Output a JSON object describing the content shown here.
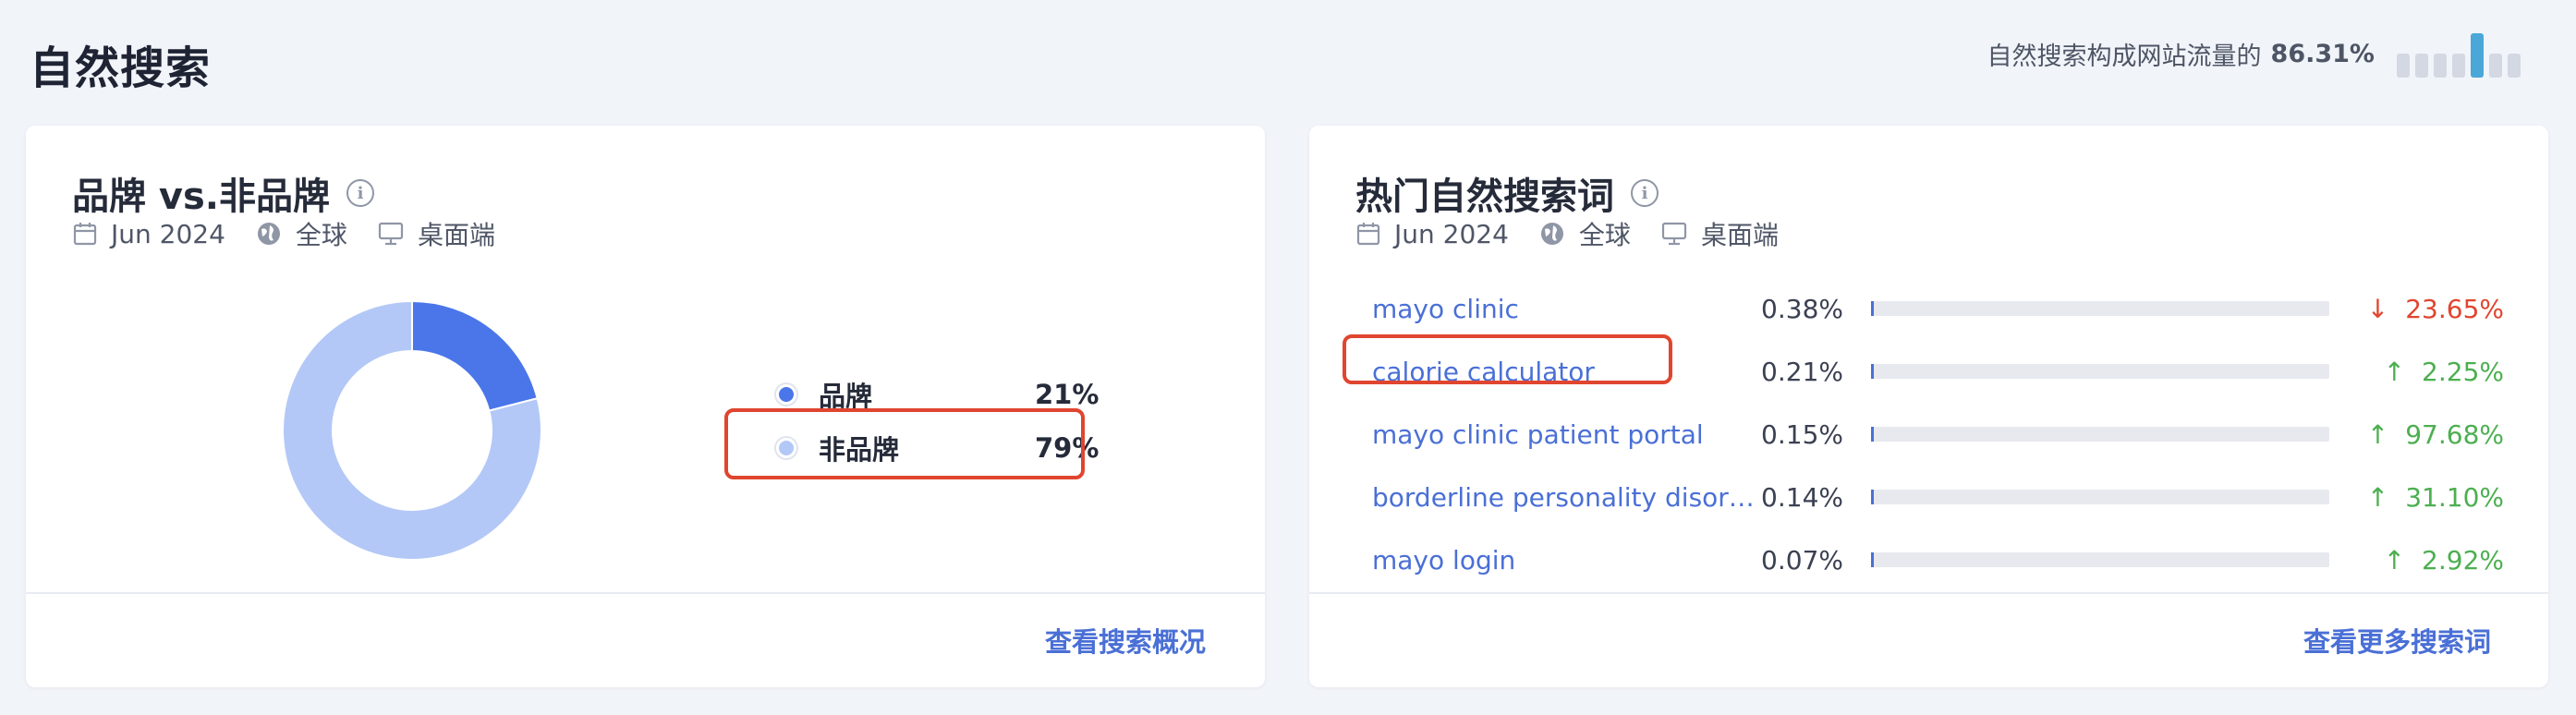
{
  "page": {
    "title": "自然搜索",
    "traffic_label": "自然搜索构成网站流量的",
    "traffic_value": "86.31%"
  },
  "colors": {
    "accent": "#4a6fd6",
    "brand_slice": "#4a76ea",
    "nonbrand_slice": "#b3c8f7",
    "up": "#4caf50",
    "down": "#e0452f",
    "highlight": "#e0452f"
  },
  "brand_card": {
    "title": "品牌 vs.非品牌",
    "date": "Jun 2024",
    "region": "全球",
    "device": "桌面端",
    "legend": [
      {
        "label": "品牌",
        "value": "21%",
        "color": "#4a76ea"
      },
      {
        "label": "非品牌",
        "value": "79%",
        "color": "#b3c8f7"
      }
    ],
    "footer_link": "查看搜索概况"
  },
  "chart_data": {
    "type": "pie",
    "categories": [
      "品牌",
      "非品牌"
    ],
    "values": [
      21,
      79
    ],
    "title": "品牌 vs.非品牌"
  },
  "keywords_card": {
    "title": "热门自然搜索词",
    "date": "Jun 2024",
    "region": "全球",
    "device": "桌面端",
    "rows": [
      {
        "term": "mayo clinic",
        "share": "0.38%",
        "change": "23.65%",
        "direction": "down"
      },
      {
        "term": "calorie calculator",
        "share": "0.21%",
        "change": "2.25%",
        "direction": "up"
      },
      {
        "term": "mayo clinic patient portal",
        "share": "0.15%",
        "change": "97.68%",
        "direction": "up"
      },
      {
        "term": "borderline personality disor…",
        "share": "0.14%",
        "change": "31.10%",
        "direction": "up"
      },
      {
        "term": "mayo login",
        "share": "0.07%",
        "change": "2.92%",
        "direction": "up"
      }
    ],
    "footer_link": "查看更多搜索词"
  },
  "icons": {
    "calendar": "calendar-icon",
    "globe": "globe-icon",
    "desktop": "desktop-icon",
    "info": "info-icon"
  }
}
